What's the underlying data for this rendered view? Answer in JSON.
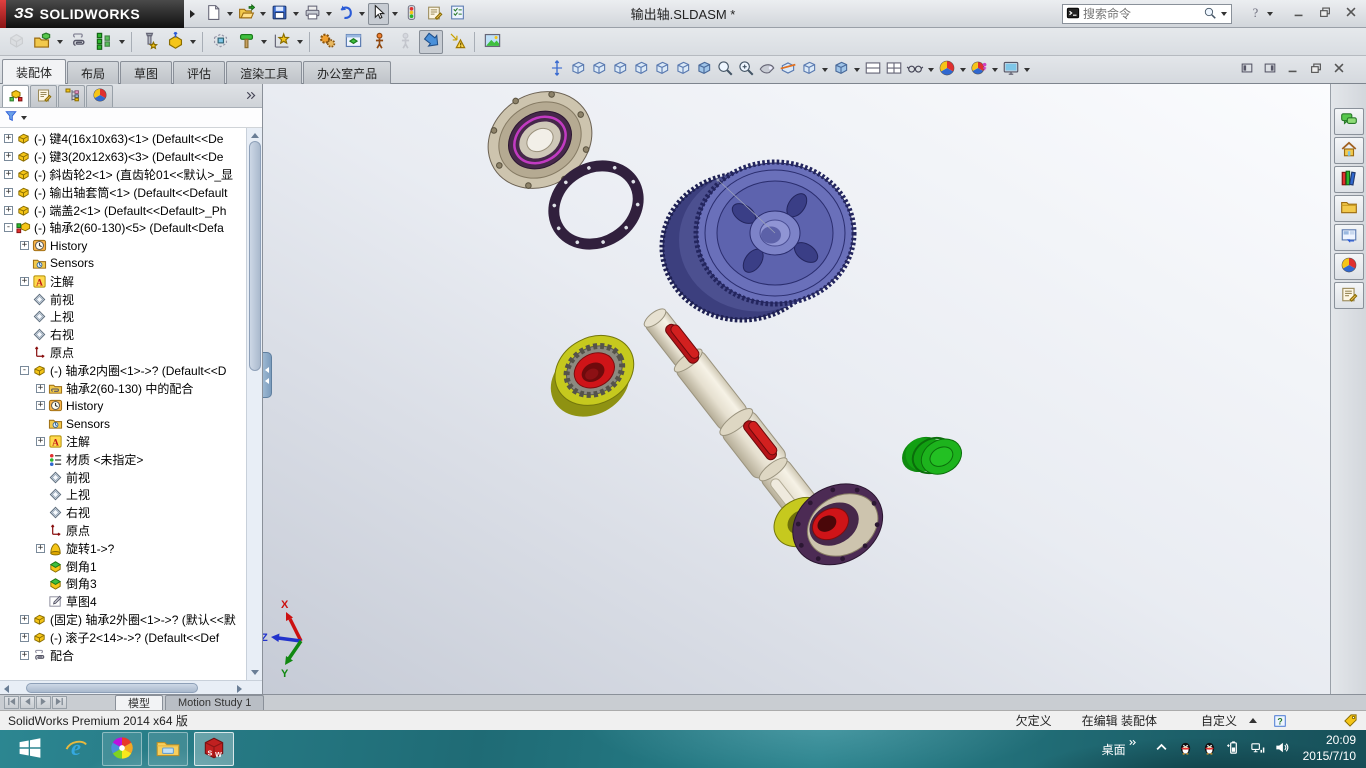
{
  "window": {
    "logo_mark": "ЗS",
    "logo_name": "SOLIDWORKS",
    "title": "输出轴.SLDASM *",
    "controls": [
      {
        "name": "minimize-window",
        "icon": "winmin"
      },
      {
        "name": "restore-window",
        "icon": "winrestore"
      },
      {
        "name": "close-window",
        "icon": "winclose"
      }
    ]
  },
  "search": {
    "placeholder": "搜索命令",
    "icons": [
      "terminal-icon",
      "magnifier-icon",
      "dropdown-arrow-icon"
    ]
  },
  "toolbars": {
    "standard": [
      {
        "name": "new-document",
        "icon": "newdoc",
        "dd": true
      },
      {
        "name": "open-document",
        "icon": "open",
        "dd": true
      },
      {
        "name": "save",
        "icon": "save",
        "dd": true
      },
      {
        "name": "print",
        "icon": "print",
        "dd": true
      },
      {
        "name": "undo",
        "icon": "undo",
        "dd": true
      },
      {
        "name": "select",
        "icon": "cursor",
        "pressed": true,
        "dd": true
      },
      {
        "name": "interference-detection",
        "icon": "traffic"
      },
      {
        "name": "options",
        "icon": "propsheet"
      },
      {
        "name": "design-checker",
        "icon": "checklist"
      }
    ],
    "assembly": [
      {
        "name": "insert-components",
        "icon": "inscomp",
        "disabled": true
      },
      {
        "name": "insert-component-open",
        "icon": "openpart",
        "dd": true
      },
      {
        "name": "mate",
        "icon": "clip"
      },
      {
        "name": "linear-component-pattern",
        "icon": "pattern",
        "dd": true
      },
      {
        "sep": true
      },
      {
        "name": "smart-fasteners",
        "icon": "fastener",
        "boxed": true
      },
      {
        "name": "move-component",
        "icon": "movecomp",
        "dd": true
      },
      {
        "sep": true
      },
      {
        "name": "show-hidden-components",
        "icon": "hiddencomp"
      },
      {
        "name": "assembly-features",
        "icon": "asmfeat",
        "dd": true
      },
      {
        "name": "reference-geometry",
        "icon": "refgeom",
        "dd": true
      },
      {
        "sep": true
      },
      {
        "name": "new-motion-study",
        "icon": "gears"
      },
      {
        "name": "bill-of-materials",
        "icon": "previewwin"
      },
      {
        "name": "move-rotate-component",
        "icon": "moverotate"
      },
      {
        "name": "component-preview",
        "icon": "grayfigure",
        "disabled": true
      },
      {
        "name": "exploded-view",
        "icon": "explodedview",
        "pressed": true
      },
      {
        "name": "explode-line-sketch",
        "icon": "explodesketch"
      },
      {
        "sep": true
      },
      {
        "name": "render-image",
        "icon": "imageicon"
      }
    ],
    "headsup": [
      {
        "name": "zoom-fit-vertical",
        "icon": "updown"
      },
      {
        "name": "view-cube-1",
        "icon": "cubewire"
      },
      {
        "name": "view-cube-2",
        "icon": "cubewire"
      },
      {
        "name": "view-cube-3",
        "icon": "cubewire"
      },
      {
        "name": "view-cube-4",
        "icon": "cubewire"
      },
      {
        "name": "view-cube-5",
        "icon": "cubewire"
      },
      {
        "name": "view-cube-6",
        "icon": "cubewire"
      },
      {
        "name": "view-cube-iso",
        "icon": "cubesolid"
      },
      {
        "name": "zoom-to-fit",
        "icon": "magnifier"
      },
      {
        "name": "zoom-to-area",
        "icon": "magnifier2"
      },
      {
        "name": "rotate-view",
        "icon": "fly"
      },
      {
        "name": "section-view",
        "icon": "sectioncube"
      },
      {
        "name": "view-orientation",
        "icon": "cubewire",
        "dd": true
      },
      {
        "name": "display-style",
        "icon": "cubesolid",
        "dd": true
      },
      {
        "name": "viewport-single",
        "icon": "paneh"
      },
      {
        "name": "viewport-grid",
        "icon": "panegrid"
      },
      {
        "name": "hide-show-items",
        "icon": "glasses",
        "dd": true
      },
      {
        "name": "edit-appearance",
        "icon": "ballcolor",
        "dd": true
      },
      {
        "name": "apply-scene",
        "icon": "ballperson",
        "dd": true
      },
      {
        "name": "view-settings",
        "icon": "monitor",
        "dd": true
      }
    ],
    "doc_controls": [
      {
        "name": "pane-left",
        "icon": "splitl"
      },
      {
        "name": "pane-right",
        "icon": "splitr"
      },
      {
        "name": "minimize-document",
        "icon": "winmin"
      },
      {
        "name": "restore-document",
        "icon": "winrestore"
      },
      {
        "name": "close-document",
        "icon": "winclose"
      }
    ]
  },
  "command_tabs": {
    "active": "装配体",
    "items": [
      "装配体",
      "布局",
      "草图",
      "评估",
      "渲染工具",
      "办公室产品"
    ]
  },
  "feature_panel": {
    "tabs": [
      {
        "name": "featuremanager-tab",
        "icon": "fmtab",
        "active": true
      },
      {
        "name": "propertymanager-tab",
        "icon": "propsheet"
      },
      {
        "name": "configurationmanager-tab",
        "icon": "cmtab"
      },
      {
        "name": "displaymanager-tab",
        "icon": "ballcolor"
      }
    ],
    "filter_icon": "funnel",
    "bottom_tabs": [
      "模型",
      "Motion Study 1"
    ],
    "tree": [
      {
        "indent": 0,
        "expand": "+",
        "icon": "part",
        "label": "(-) 键4(16x10x63)<1> (Default<<De"
      },
      {
        "indent": 0,
        "expand": "+",
        "icon": "part",
        "label": "(-) 键3(20x12x63)<3> (Default<<De"
      },
      {
        "indent": 0,
        "expand": "+",
        "icon": "part",
        "label": "(-) 斜齿轮2<1> (直齿轮01<<默认>_显"
      },
      {
        "indent": 0,
        "expand": "+",
        "icon": "part",
        "label": "(-) 输出轴套筒<1> (Default<<Default"
      },
      {
        "indent": 0,
        "expand": "+",
        "icon": "part",
        "label": "(-) 端盖2<1> (Default<<Default>_Ph"
      },
      {
        "indent": 0,
        "expand": "-",
        "icon": "assembly",
        "label": "(-) 轴承2(60-130)<5> (Default<Defa"
      },
      {
        "indent": 1,
        "expand": "+",
        "icon": "history",
        "label": "History"
      },
      {
        "indent": 1,
        "expand": null,
        "icon": "sensors",
        "label": "Sensors"
      },
      {
        "indent": 1,
        "expand": "+",
        "icon": "ann",
        "label": "注解"
      },
      {
        "indent": 1,
        "expand": null,
        "icon": "plane",
        "label": "前视"
      },
      {
        "indent": 1,
        "expand": null,
        "icon": "plane",
        "label": "上视"
      },
      {
        "indent": 1,
        "expand": null,
        "icon": "plane",
        "label": "右视"
      },
      {
        "indent": 1,
        "expand": null,
        "icon": "origin",
        "label": "原点"
      },
      {
        "indent": 1,
        "expand": "-",
        "icon": "part",
        "label": "(-) 轴承2内圈<1>->? (Default<<D"
      },
      {
        "indent": 2,
        "expand": "+",
        "icon": "matefolder",
        "label": "轴承2(60-130) 中的配合"
      },
      {
        "indent": 2,
        "expand": "+",
        "icon": "history",
        "label": "History"
      },
      {
        "indent": 2,
        "expand": null,
        "icon": "sensors",
        "label": "Sensors"
      },
      {
        "indent": 2,
        "expand": "+",
        "icon": "ann",
        "label": "注解"
      },
      {
        "indent": 2,
        "expand": null,
        "icon": "material",
        "label": "材质 <未指定>"
      },
      {
        "indent": 2,
        "expand": null,
        "icon": "plane",
        "label": "前视"
      },
      {
        "indent": 2,
        "expand": null,
        "icon": "plane",
        "label": "上视"
      },
      {
        "indent": 2,
        "expand": null,
        "icon": "plane",
        "label": "右视"
      },
      {
        "indent": 2,
        "expand": null,
        "icon": "origin",
        "label": "原点"
      },
      {
        "indent": 2,
        "expand": "+",
        "icon": "revolve",
        "label": "旋转1->?"
      },
      {
        "indent": 2,
        "expand": null,
        "icon": "chamfer",
        "label": "倒角1"
      },
      {
        "indent": 2,
        "expand": null,
        "icon": "chamfer",
        "label": "倒角3"
      },
      {
        "indent": 2,
        "expand": null,
        "icon": "sketch",
        "label": "草图4"
      },
      {
        "indent": 1,
        "expand": "+",
        "icon": "part",
        "label": "(固定) 轴承2外圈<1>->? (默认<<默"
      },
      {
        "indent": 1,
        "expand": "+",
        "icon": "part",
        "label": "(-) 滚子2<14>->? (Default<<Def"
      },
      {
        "indent": 1,
        "expand": "+",
        "icon": "clip",
        "label": "配合"
      }
    ]
  },
  "task_pane": {
    "items": [
      {
        "name": "solidworks-forum",
        "icon": "chat"
      },
      {
        "name": "solidworks-resources",
        "icon": "home"
      },
      {
        "name": "design-library",
        "icon": "books"
      },
      {
        "name": "file-explorer-pane",
        "icon": "folderplain"
      },
      {
        "name": "view-palette",
        "icon": "palette"
      },
      {
        "name": "appearances-scenes",
        "icon": "ballcolor"
      },
      {
        "name": "custom-properties",
        "icon": "propsheet"
      }
    ]
  },
  "status_bar": {
    "product": "SolidWorks Premium 2014 x64 版",
    "state": "欠定义",
    "editing": "在编辑 装配体",
    "custom": "自定义",
    "icons": [
      "quick-tip-icon",
      "tag-icon"
    ]
  },
  "media_controls": [
    {
      "name": "go-to-start",
      "icon": "mfirst"
    },
    {
      "name": "step-back",
      "icon": "mprev"
    },
    {
      "name": "play-forward",
      "icon": "mnext"
    },
    {
      "name": "go-to-end",
      "icon": "mlast"
    }
  ],
  "taskbar": {
    "buttons": [
      {
        "name": "start",
        "icon": "winflag"
      },
      {
        "name": "internet-explorer",
        "icon": "ie"
      },
      {
        "name": "browser-360",
        "icon": "pinwheel",
        "framed": true
      },
      {
        "name": "file-explorer",
        "icon": "explorerfolder",
        "framed": true
      },
      {
        "name": "solidworks",
        "icon": "swcube",
        "active": true
      }
    ],
    "desktop": "桌面",
    "tray": [
      {
        "name": "show-hidden-icons",
        "icon": "trayup"
      },
      {
        "name": "qq-1",
        "icon": "penguin"
      },
      {
        "name": "qq-2",
        "icon": "penguin"
      },
      {
        "name": "power",
        "icon": "battery"
      },
      {
        "name": "network",
        "icon": "net"
      },
      {
        "name": "volume",
        "icon": "speaker"
      }
    ],
    "time": "20:09",
    "date": "2015/7/10"
  },
  "viewport": {
    "triad": {
      "x": "X",
      "y": "Y",
      "z": "Z"
    },
    "components": [
      {
        "name": "end-cap",
        "color": "#cdc4ae"
      },
      {
        "name": "gasket",
        "color": "#31203d"
      },
      {
        "name": "helical-gear",
        "color": "#6a70ba"
      },
      {
        "name": "bearing-outer",
        "color": "#c6c91e"
      },
      {
        "name": "bearing-inner",
        "color": "#cf1418"
      },
      {
        "name": "shaft",
        "color": "#efeade"
      },
      {
        "name": "key",
        "color": "#d2201f"
      },
      {
        "name": "flange-cover",
        "color": "#4c2b54"
      },
      {
        "name": "green-cap",
        "color": "#1db31d"
      }
    ]
  }
}
